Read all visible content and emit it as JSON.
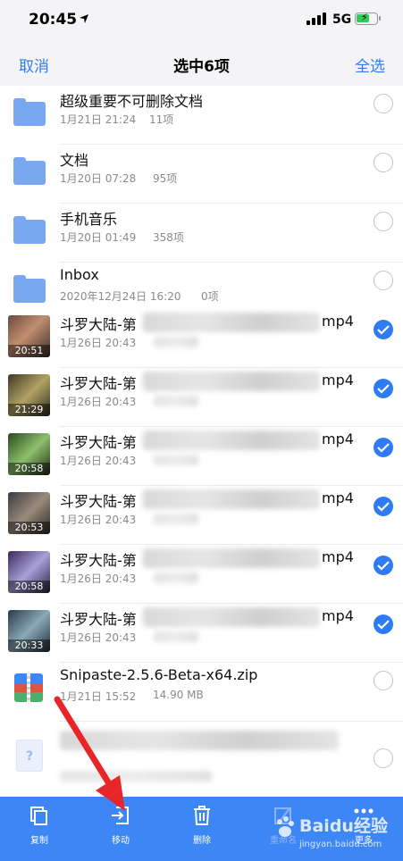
{
  "status_bar": {
    "time": "20:45",
    "network": "5G"
  },
  "nav": {
    "cancel": "取消",
    "title": "选中6项",
    "select_all": "全选"
  },
  "folders": [
    {
      "name": "超级重要不可删除文档",
      "date": "1月21日 21:24",
      "count": "11项"
    },
    {
      "name": "文档",
      "date": "1月20日 07:28",
      "count": "95项"
    },
    {
      "name": "手机音乐",
      "date": "1月20日 01:49",
      "count": "358项"
    },
    {
      "name": "Inbox",
      "date": "2020年12月24日 16:20",
      "count": "0项"
    }
  ],
  "videos": [
    {
      "name_prefix": "斗罗大陆-第",
      "ext": "mp4",
      "date": "1月26日 20:43",
      "duration": "20:51",
      "checked": true
    },
    {
      "name_prefix": "斗罗大陆-第",
      "ext": "mp4",
      "date": "1月26日 20:43",
      "duration": "21:29",
      "checked": true
    },
    {
      "name_prefix": "斗罗大陆-第",
      "ext": "mp4",
      "date": "1月26日 20:43",
      "duration": "20:58",
      "checked": true
    },
    {
      "name_prefix": "斗罗大陆-第",
      "ext": "mp4",
      "date": "1月26日 20:43",
      "duration": "20:53",
      "checked": true
    },
    {
      "name_prefix": "斗罗大陆-第",
      "ext": "mp4",
      "date": "1月26日 20:43",
      "duration": "20:58",
      "checked": true
    },
    {
      "name_prefix": "斗罗大陆-第",
      "ext": "mp4",
      "date": "1月26日 20:43",
      "duration": "20:33",
      "checked": true
    }
  ],
  "zip_file": {
    "name": "Snipaste-2.5.6-Beta-x64.zip",
    "date": "1月21日 15:52",
    "size": "14.90 MB"
  },
  "toolbar": {
    "copy": "复制",
    "move": "移动",
    "delete": "删除",
    "rename": "重命名",
    "more": "更多"
  },
  "watermark": {
    "text": "Baidu经验",
    "url": "jingyan.baidu.com"
  },
  "colors": {
    "accent": "#2f7bf6",
    "toolbar": "#3d86f5",
    "folder": "#7aa8f0",
    "arrow": "#e8262a"
  }
}
